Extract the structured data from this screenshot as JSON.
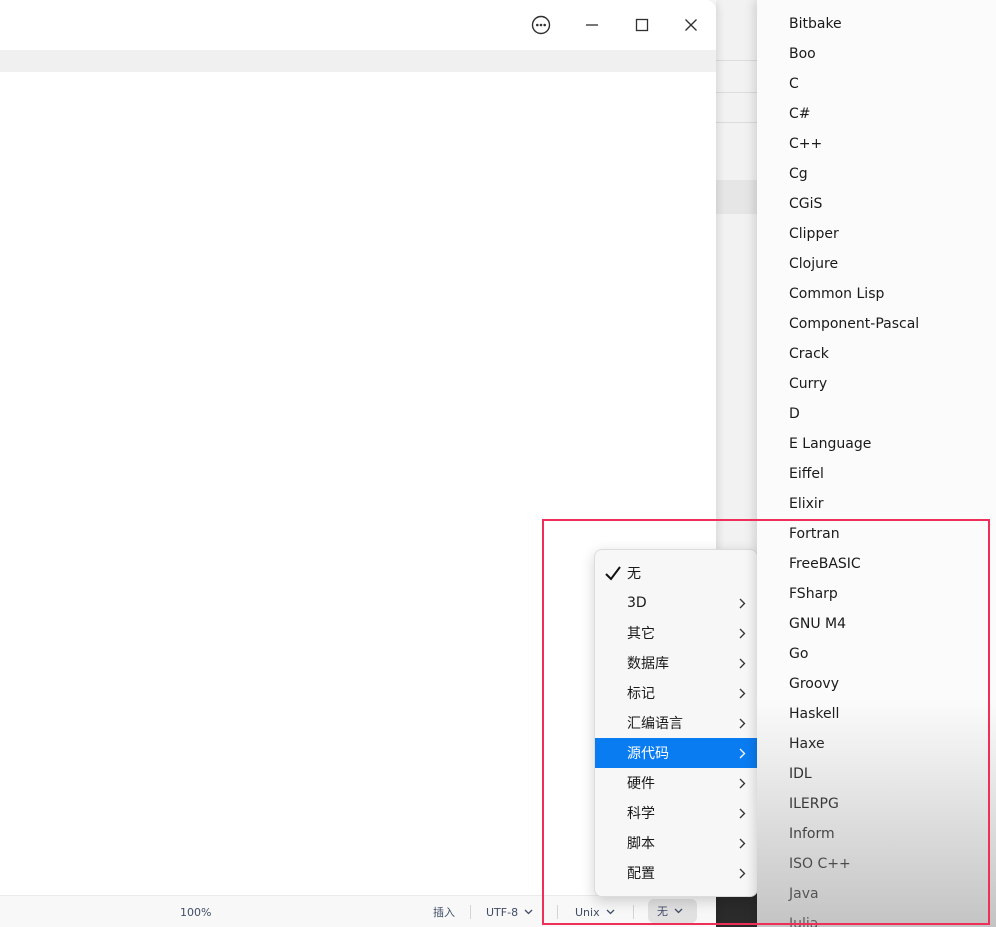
{
  "window": {
    "controls": [
      "more-icon",
      "minimize-icon",
      "maximize-icon",
      "close-icon"
    ]
  },
  "statusbar": {
    "zoom": "100%",
    "mode": "插入",
    "encoding": "UTF-8",
    "line_ending": "Unix",
    "highlight": "无"
  },
  "menu": {
    "items": [
      {
        "label": "无",
        "checked": true
      },
      {
        "label": "3D"
      },
      {
        "label": "其它"
      },
      {
        "label": "数据库"
      },
      {
        "label": "标记"
      },
      {
        "label": "汇编语言"
      },
      {
        "label": "源代码",
        "selected": true
      },
      {
        "label": "硬件"
      },
      {
        "label": "科学"
      },
      {
        "label": "脚本"
      },
      {
        "label": "配置"
      }
    ]
  },
  "submenu": {
    "items": [
      "Bitbake",
      "Boo",
      "C",
      "C#",
      "C++",
      "Cg",
      "CGiS",
      "Clipper",
      "Clojure",
      "Common Lisp",
      "Component-Pascal",
      "Crack",
      "Curry",
      "D",
      "E Language",
      "Eiffel",
      "Elixir",
      "Fortran",
      "FreeBASIC",
      "FSharp",
      "GNU M4",
      "Go",
      "Groovy",
      "Haskell",
      "Haxe",
      "IDL",
      "ILERPG",
      "Inform",
      "ISO C++",
      "Java",
      "Julia"
    ]
  },
  "colors": {
    "selected_bg": "#0a7cf2",
    "highlight_border": "#ee2f5a"
  }
}
